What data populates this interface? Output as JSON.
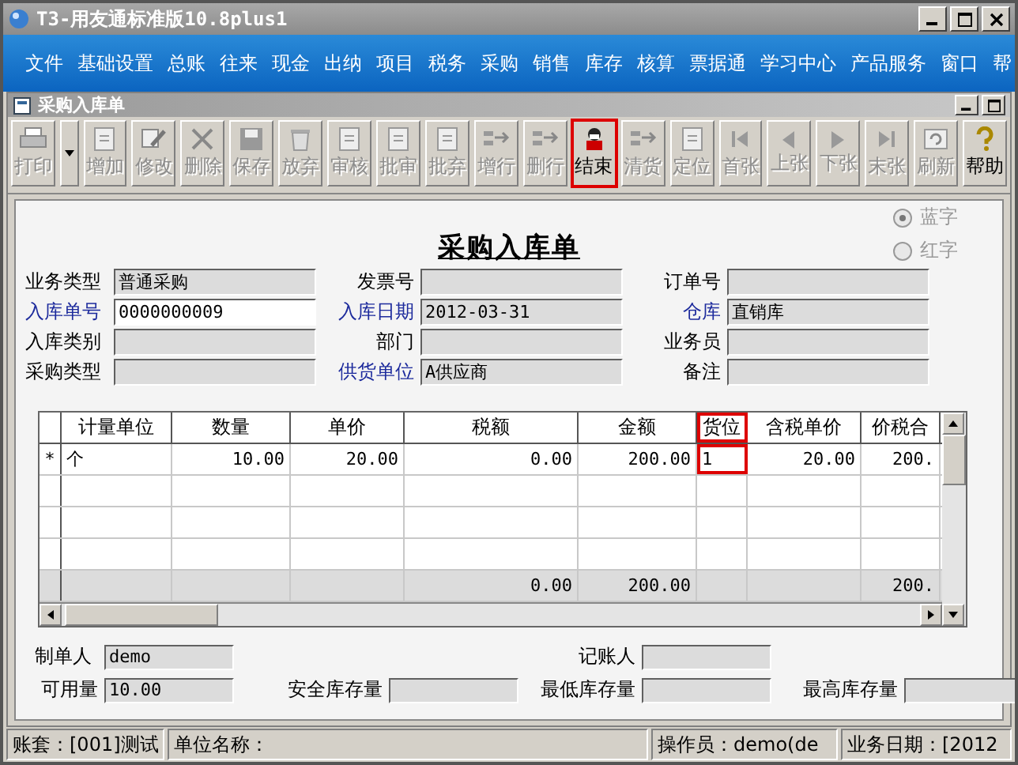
{
  "window": {
    "title": "T3-用友通标准版10.8plus1"
  },
  "menu": [
    "文件",
    "基础设置",
    "总账",
    "往来",
    "现金",
    "出纳",
    "项目",
    "税务",
    "采购",
    "销售",
    "库存",
    "核算",
    "票据通",
    "学习中心",
    "产品服务",
    "窗口",
    "帮"
  ],
  "document_window": {
    "title": "采购入库单"
  },
  "toolbar": [
    {
      "label": "打印",
      "kind": "printer",
      "disabled": true,
      "highlighted": false,
      "dropdown": true
    },
    {
      "label": "增加",
      "kind": "doc",
      "disabled": true,
      "highlighted": false
    },
    {
      "label": "修改",
      "kind": "pencil",
      "disabled": true,
      "highlighted": false
    },
    {
      "label": "删除",
      "kind": "cross",
      "disabled": true,
      "highlighted": false
    },
    {
      "label": "保存",
      "kind": "disk",
      "disabled": true,
      "highlighted": false
    },
    {
      "label": "放弃",
      "kind": "trash",
      "disabled": true,
      "highlighted": false
    },
    {
      "label": "审核",
      "kind": "doc",
      "disabled": true,
      "highlighted": false
    },
    {
      "label": "批审",
      "kind": "doc",
      "disabled": true,
      "highlighted": false
    },
    {
      "label": "批弃",
      "kind": "doc",
      "disabled": true,
      "highlighted": false
    },
    {
      "label": "增行",
      "kind": "rows",
      "disabled": true,
      "highlighted": false
    },
    {
      "label": "删行",
      "kind": "rows",
      "disabled": true,
      "highlighted": false
    },
    {
      "label": "结束",
      "kind": "person",
      "disabled": false,
      "highlighted": true
    },
    {
      "label": "清货",
      "kind": "rows",
      "disabled": true,
      "highlighted": false
    },
    {
      "label": "定位",
      "kind": "doc",
      "disabled": true,
      "highlighted": false
    },
    {
      "label": "首张",
      "kind": "first",
      "disabled": true,
      "highlighted": false
    },
    {
      "label": "上张",
      "kind": "prev",
      "disabled": true,
      "highlighted": false
    },
    {
      "label": "下张",
      "kind": "next",
      "disabled": true,
      "highlighted": false
    },
    {
      "label": "末张",
      "kind": "last",
      "disabled": true,
      "highlighted": false
    },
    {
      "label": "刷新",
      "kind": "refresh",
      "disabled": true,
      "highlighted": false
    },
    {
      "label": "帮助",
      "kind": "question",
      "disabled": false,
      "highlighted": false
    }
  ],
  "color_options": [
    {
      "label": "蓝字",
      "selected": true
    },
    {
      "label": "红字",
      "selected": false
    }
  ],
  "form_title": "采购入库单",
  "header_fields": [
    {
      "label": "业务类型",
      "value": "普通采购",
      "required": false,
      "editable": false
    },
    {
      "label": "发票号",
      "required": false,
      "editable": false
    },
    {
      "label": "订单号",
      "required": false,
      "editable": false
    },
    {
      "label": "入库单号",
      "value": "0000000009",
      "required": true,
      "editable": true
    },
    {
      "label": "入库日期",
      "value": "2012-03-31",
      "required": true,
      "editable": false
    },
    {
      "label": "仓库",
      "value": "直销库",
      "required": true,
      "editable": false
    },
    {
      "label": "入库类别",
      "required": false,
      "editable": false
    },
    {
      "label": "部门",
      "required": false,
      "editable": false
    },
    {
      "label": "业务员",
      "required": false,
      "editable": false
    },
    {
      "label": "采购类型",
      "required": false,
      "editable": false
    },
    {
      "label": "供货单位",
      "value": "A供应商",
      "required": true,
      "editable": false
    },
    {
      "label": "备注",
      "required": false,
      "editable": false
    }
  ],
  "table": {
    "columns": [
      {
        "label": "计量单位",
        "highlighted": false
      },
      {
        "label": "数量",
        "highlighted": false
      },
      {
        "label": "单价",
        "highlighted": false
      },
      {
        "label": "税额",
        "highlighted": false,
        "total": "0.00"
      },
      {
        "label": "金额",
        "highlighted": false,
        "total": "200.00"
      },
      {
        "label": "货位",
        "highlighted": true
      },
      {
        "label": "含税单价",
        "highlighted": false
      },
      {
        "label": "价税合",
        "highlighted": false,
        "total": "200."
      }
    ],
    "rows": [
      {
        "marker": "*",
        "cells": [
          "个",
          "10.00",
          "20.00",
          "0.00",
          "200.00",
          "1",
          "20.00",
          "200."
        ]
      },
      {},
      {},
      {}
    ]
  },
  "footer_fields": [
    {
      "label": "制单人",
      "value": "demo"
    },
    {
      "label": "记账人"
    },
    {
      "label": "可用量",
      "value": "10.00"
    },
    {
      "label": "安全库存量"
    },
    {
      "label": "最低库存量"
    },
    {
      "label": "最高库存量"
    }
  ],
  "status_bar": [
    "账套：[001]测试",
    "单位名称：",
    "操作员：demo(de",
    "业务日期：[2012"
  ]
}
